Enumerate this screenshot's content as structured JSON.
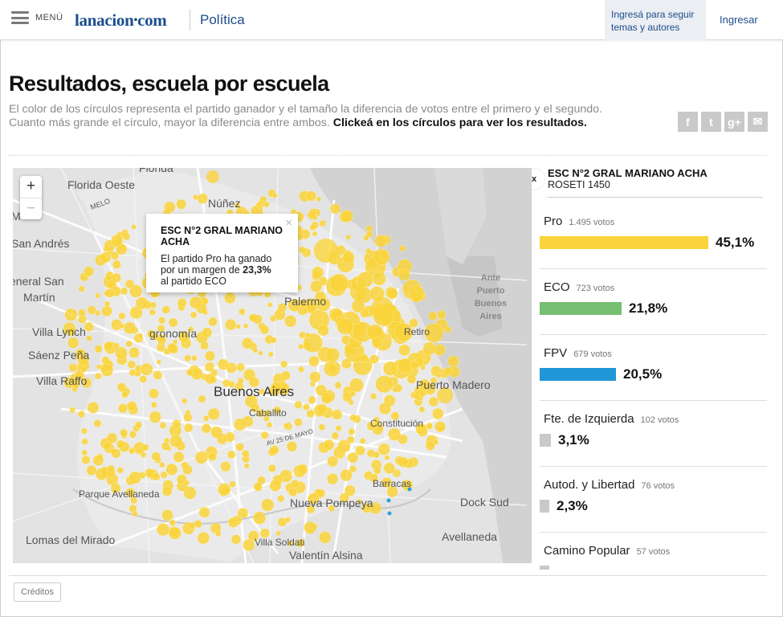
{
  "header": {
    "menu_label": "MENÚ",
    "logo_text": "lanacion",
    "logo_suffix": "com",
    "section": "Política",
    "follow_text": "Ingresá para seguir temas y autores",
    "login": "Ingresar"
  },
  "article": {
    "title": "Resultados, escuela por escuela",
    "description": "El color de los círculos representa el partido ganador y el tamaño la diferencia de votos entre el primero y el segundo. Cuanto más grande el círculo, mayor la diferencia entre ambos.",
    "description_bold": "Clickeá en los círculos para ver los resultados.",
    "share": [
      {
        "icon": "facebook-icon",
        "glyph": "f"
      },
      {
        "icon": "twitter-icon",
        "glyph": "t"
      },
      {
        "icon": "google-plus-icon",
        "glyph": "g+"
      },
      {
        "icon": "email-icon",
        "glyph": "✉"
      }
    ]
  },
  "map": {
    "zoom_in": "+",
    "zoom_out": "−",
    "labels": {
      "florida": "Florida",
      "florida_oeste": "Florida Oeste",
      "melo": "MELO",
      "nunez": "Núñez",
      "san_andres": "San Andrés",
      "general_san_martin_1": "eneral San",
      "general_san_martin_2": "Martín",
      "villa_lynch": "Villa Lynch",
      "saenz_pena": "Sáenz Peña",
      "villa_raffo": "Villa Raffo",
      "agronomia": "gronomía",
      "palermo": "Palermo",
      "retiro": "Retiro",
      "buenos_aires": "Buenos Aires",
      "caballito": "Caballito",
      "puerto_madero": "Puerto Madero",
      "constitucion": "Constitución",
      "av_25_mayo": "AV 25 DE MAYO",
      "parque_avellaneda": "Parque Avellaneda",
      "barracas": "Barracas",
      "nueva_pompeya": "Nueva Pompeya",
      "dock_sud": "Dock Sud",
      "lomas_del_mirador": "Lomas del Mirado",
      "villa_soldati": "Villa Soldati",
      "valentin_alsina": "Valentín Alsina",
      "avellaneda": "Avellaneda",
      "ante_puerto": "Ante Puerto Buenos Aires",
      "m_label": "M"
    },
    "colors": {
      "pro": "#f9d43a",
      "fpv": "#2aa1d8"
    },
    "popup": {
      "title": "ESC N°2 GRAL MARIANO ACHA",
      "body_pre": "El partido Pro ha ganado por un margen de",
      "margin": "23,3%",
      "body_post": "al partido ECO",
      "close": "×"
    }
  },
  "results": {
    "close": "x",
    "school_name": "ESC N°2 GRAL MARIANO ACHA",
    "school_address": "ROSETI 1450",
    "parties": [
      {
        "name": "Pro",
        "votes": "1.495 votos",
        "pct": "45,1%",
        "share": 45.1,
        "color": "#f9d43a"
      },
      {
        "name": "ECO",
        "votes": "723 votos",
        "pct": "21,8%",
        "share": 21.8,
        "color": "#76bf72"
      },
      {
        "name": "FPV",
        "votes": "679 votos",
        "pct": "20,5%",
        "share": 20.5,
        "color": "#2196d6"
      },
      {
        "name": "Fte. de Izquierda",
        "votes": "102 votos",
        "pct": "3,1%",
        "share": 3.1,
        "color": "#c9c9c9"
      },
      {
        "name": "Autod. y Libertad",
        "votes": "76 votos",
        "pct": "2,3%",
        "share": 2.3,
        "color": "#c9c9c9"
      },
      {
        "name": "Camino Popular",
        "votes": "57 votos",
        "pct": "",
        "share": 1.7,
        "color": "#c9c9c9"
      }
    ]
  },
  "footer": {
    "credits": "Créditos"
  }
}
